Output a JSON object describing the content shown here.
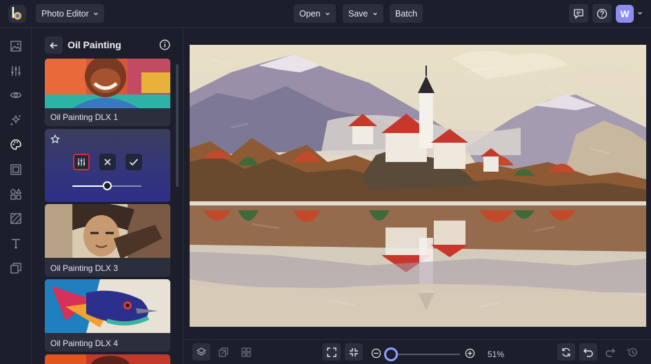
{
  "header": {
    "app_menu_label": "Photo Editor",
    "open_label": "Open",
    "save_label": "Save",
    "batch_label": "Batch",
    "user_initial": "W",
    "icons": [
      "chat-icon",
      "help-icon"
    ]
  },
  "rail": {
    "items": [
      "image-icon",
      "adjust-icon",
      "eye-icon",
      "magic-icon",
      "palette-icon",
      "frame-icon",
      "graphics-icon",
      "texture-icon",
      "text-icon",
      "collage-icon"
    ],
    "active": "palette-icon"
  },
  "panel": {
    "title": "Oil Painting",
    "presets": [
      {
        "label": "Oil Painting DLX 1"
      },
      {
        "label": "Oil Painting DLX 3"
      },
      {
        "label": "Oil Painting DLX 4"
      }
    ],
    "active_preset": {
      "intensity": 0.5,
      "actions": [
        "settings-icon",
        "cancel-icon",
        "apply-icon"
      ]
    }
  },
  "bottom": {
    "zoom_label": "51%",
    "zoom_level": 0.0
  },
  "colors": {
    "accent": "#8d8cf0",
    "selected_outline": "#d0312d",
    "background": "#1c1f2b"
  }
}
